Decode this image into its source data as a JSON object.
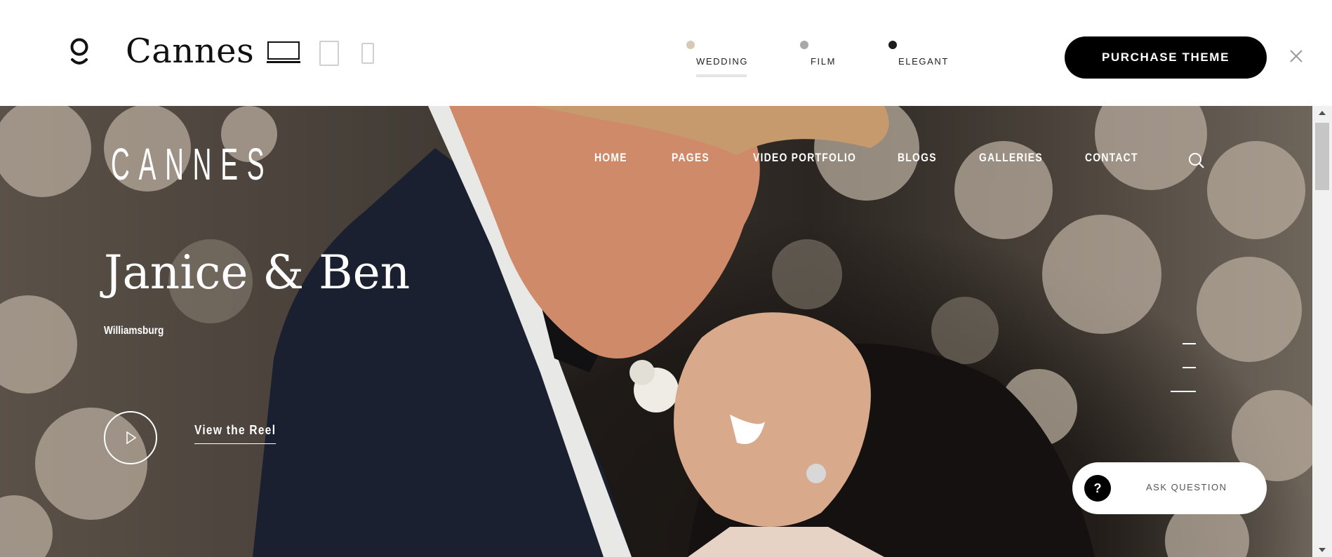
{
  "topbar": {
    "brand_name": "Cannes",
    "demos": [
      {
        "label": "WEDDING",
        "dot_color": "#d8c9b6",
        "active": true
      },
      {
        "label": "FILM",
        "dot_color": "#a9a9a9",
        "active": false
      },
      {
        "label": "ELEGANT",
        "dot_color": "#1c1c1c",
        "active": false
      }
    ],
    "purchase_label": "PURCHASE THEME"
  },
  "site": {
    "logo": "CANNES",
    "nav": [
      "HOME",
      "PAGES",
      "VIDEO PORTFOLIO",
      "BLOGS",
      "GALLERIES",
      "CONTACT"
    ],
    "hero_title": "Janice & Ben",
    "hero_location": "Williamsburg",
    "reel_label": "View the Reel",
    "slide_count": 3
  },
  "ask": {
    "icon_text": "?",
    "label": "ASK QUESTION"
  },
  "colors": {
    "accent": "#000000",
    "text_on_dark": "#ffffff",
    "wedding_dot": "#d8c9b6"
  },
  "icons": [
    "logo-mark-icon",
    "desktop-icon",
    "tablet-icon",
    "mobile-icon",
    "close-icon",
    "search-icon",
    "play-icon",
    "question-icon",
    "scroll-up-icon",
    "scroll-down-icon"
  ]
}
